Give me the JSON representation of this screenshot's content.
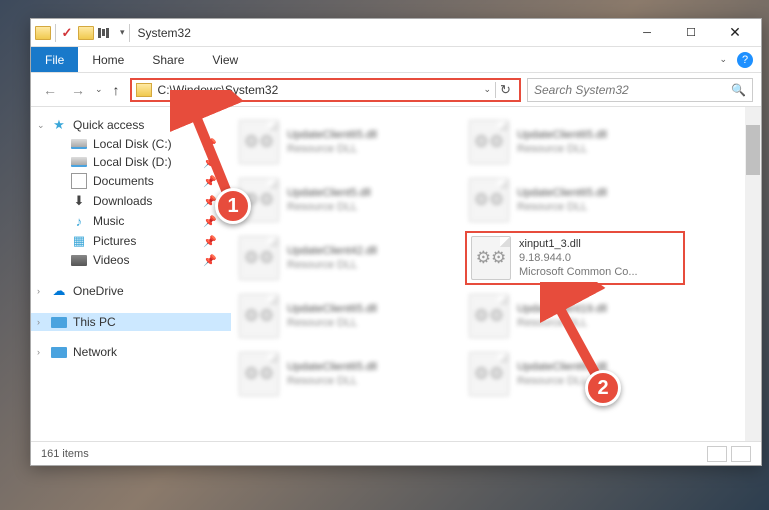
{
  "window": {
    "title": "System32"
  },
  "menu": {
    "file": "File",
    "home": "Home",
    "share": "Share",
    "view": "View"
  },
  "nav": {
    "path": "C:\\Windows\\System32"
  },
  "search": {
    "placeholder": "Search System32"
  },
  "sidebar": {
    "quick": "Quick access",
    "items": [
      {
        "label": "Local Disk (C:)"
      },
      {
        "label": "Local Disk (D:)"
      },
      {
        "label": "Documents"
      },
      {
        "label": "Downloads"
      },
      {
        "label": "Music"
      },
      {
        "label": "Pictures"
      },
      {
        "label": "Videos"
      }
    ],
    "onedrive": "OneDrive",
    "thispc": "This PC",
    "network": "Network"
  },
  "files": {
    "blurred": [
      {
        "name": "UpdateClient65.dll",
        "type": "Resource DLL"
      },
      {
        "name": "UpdateClient65.dll",
        "type": "Resource DLL"
      },
      {
        "name": "UpdateClient5.dll",
        "type": "Resource DLL"
      },
      {
        "name": "UpdateClient65.dll",
        "type": "Resource DLL"
      },
      {
        "name": "UpdateClient42.dll",
        "type": "Resource DLL"
      },
      {
        "name": "UpdateClient65.dll",
        "type": "Resource DLL"
      },
      {
        "name": "UpdateClient19.dll",
        "type": "Resource DLL"
      },
      {
        "name": "UpdateClient65.dll",
        "type": "Resource DLL"
      },
      {
        "name": "UpdateClient65.dll",
        "type": "Resource DLL"
      }
    ],
    "highlighted": {
      "name": "xinput1_3.dll",
      "version": "9.18.944.0",
      "desc": "Microsoft Common Co..."
    }
  },
  "status": {
    "count": "161 items"
  },
  "callouts": {
    "c1": "1",
    "c2": "2"
  }
}
